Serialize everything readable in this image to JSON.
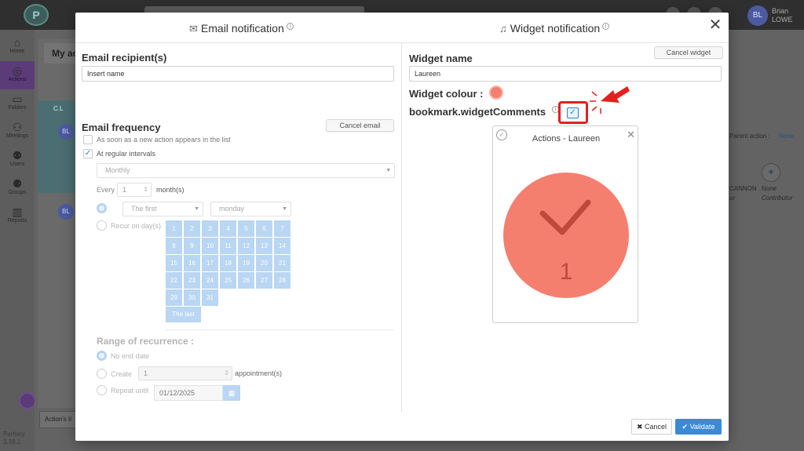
{
  "app": {
    "user_initials": "BL",
    "user_first": "Brian",
    "user_last": "LOWE",
    "sidebar": [
      {
        "label": "Home",
        "icon": "home-icon"
      },
      {
        "label": "Actions",
        "icon": "check-circle-icon"
      },
      {
        "label": "Folders",
        "icon": "folder-icon"
      },
      {
        "label": "Meetings",
        "icon": "meetings-icon"
      },
      {
        "label": "Users",
        "icon": "users-icon"
      },
      {
        "label": "Groups",
        "icon": "groups-icon"
      },
      {
        "label": "Reports",
        "icon": "reports-icon"
      }
    ],
    "sidebar_footer_name": "Perfony",
    "sidebar_footer_version": "3.39.1",
    "bg_my_actions": "My ac",
    "bg_row_initials": "BL",
    "bg_folder_tag": "C.L",
    "bg_parent_action_label": "Parent action :",
    "bg_parent_action_value": "None",
    "bg_cannon": "CANNON",
    "bg_none": "None",
    "bg_contributor": "Contributor",
    "bg_or": "or",
    "bg_action_field": "Action's ti"
  },
  "modal": {
    "email_tab": "Email notification",
    "widget_tab": "Widget notification",
    "email": {
      "recipients_title": "Email recipient(s)",
      "recipients_placeholder": "Insert name",
      "frequency_title": "Email frequency",
      "cancel_email": "Cancel email",
      "opt_new_action": "As soon as a new action appears in the list",
      "opt_regular": "At regular intervals",
      "interval": "Monthly",
      "every_label": "Every",
      "every_value": "1",
      "months_label": "month(s)",
      "nth": "The first",
      "weekday": "monday",
      "recur_on_days": "Recur on day(s)",
      "days": [
        "1",
        "2",
        "3",
        "4",
        "5",
        "6",
        "7",
        "8",
        "9",
        "10",
        "11",
        "12",
        "13",
        "14",
        "15",
        "16",
        "17",
        "18",
        "19",
        "20",
        "21",
        "22",
        "23",
        "24",
        "25",
        "26",
        "27",
        "28",
        "29",
        "30",
        "31"
      ],
      "the_last": "The last",
      "range_title": "Range of recurrence :",
      "no_end_date": "No end date",
      "create_label": "Create",
      "create_value": "1",
      "appointments_label": "appointment(s)",
      "repeat_until": "Repeat until",
      "repeat_date": "01/12/2025"
    },
    "widget": {
      "name_title": "Widget name",
      "name_value": "Laureen",
      "cancel_widget": "Cancel widget",
      "colour_label": "Widget colour :",
      "colour": "#f47f6f",
      "comments_label": "bookmark.widgetComments",
      "comments_checked": true,
      "card_title": "Actions - Laureen",
      "card_count": "1"
    },
    "cancel_label": "Cancel",
    "validate_label": "Validate"
  }
}
